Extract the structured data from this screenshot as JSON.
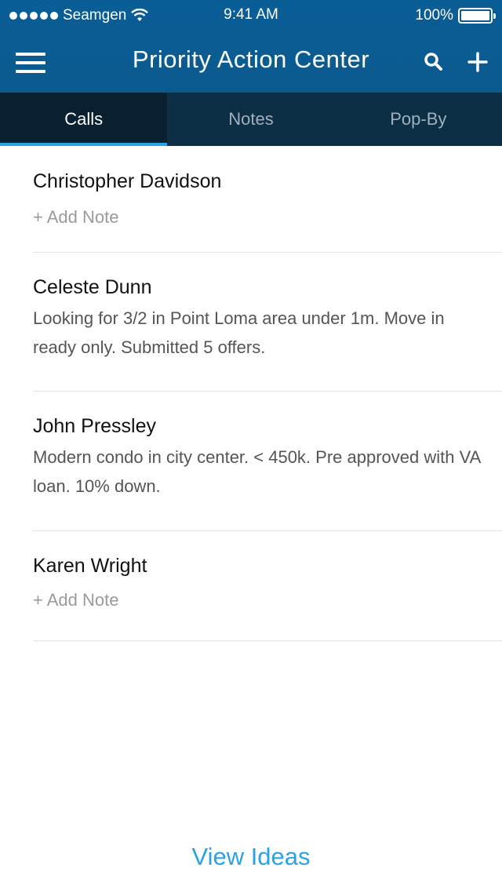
{
  "status_bar": {
    "carrier": "Seamgen",
    "time": "9:41 AM",
    "battery": "100%",
    "battery_level": 1.0,
    "signal_dots": 5
  },
  "nav": {
    "title": "Priority Action Center",
    "menu_icon": "hamburger-menu-icon",
    "search_icon": "search-icon",
    "add_icon": "plus-icon"
  },
  "tabs": [
    {
      "label": "Calls",
      "active": true
    },
    {
      "label": "Notes",
      "active": false
    },
    {
      "label": "Pop-By",
      "active": false
    }
  ],
  "contacts": [
    {
      "name": "Christopher Davidson",
      "note": "",
      "add_note_label": "+ Add Note"
    },
    {
      "name": "Celeste Dunn",
      "note": "Looking for 3/2 in Point Loma area under 1m. Move in ready only. Submitted 5 offers.",
      "add_note_label": ""
    },
    {
      "name": "John Pressley",
      "note": "Modern condo in city center. < 450k. Pre approved with VA loan. 10% down.",
      "add_note_label": ""
    },
    {
      "name": "Karen Wright",
      "note": "",
      "add_note_label": "+ Add Note"
    }
  ],
  "footer": {
    "view_ideas_label": "View Ideas"
  },
  "colors": {
    "header": "#0b5a8f",
    "tab_bar": "#0d2f45",
    "tab_active": "#08202f",
    "accent": "#2aa3e6"
  }
}
